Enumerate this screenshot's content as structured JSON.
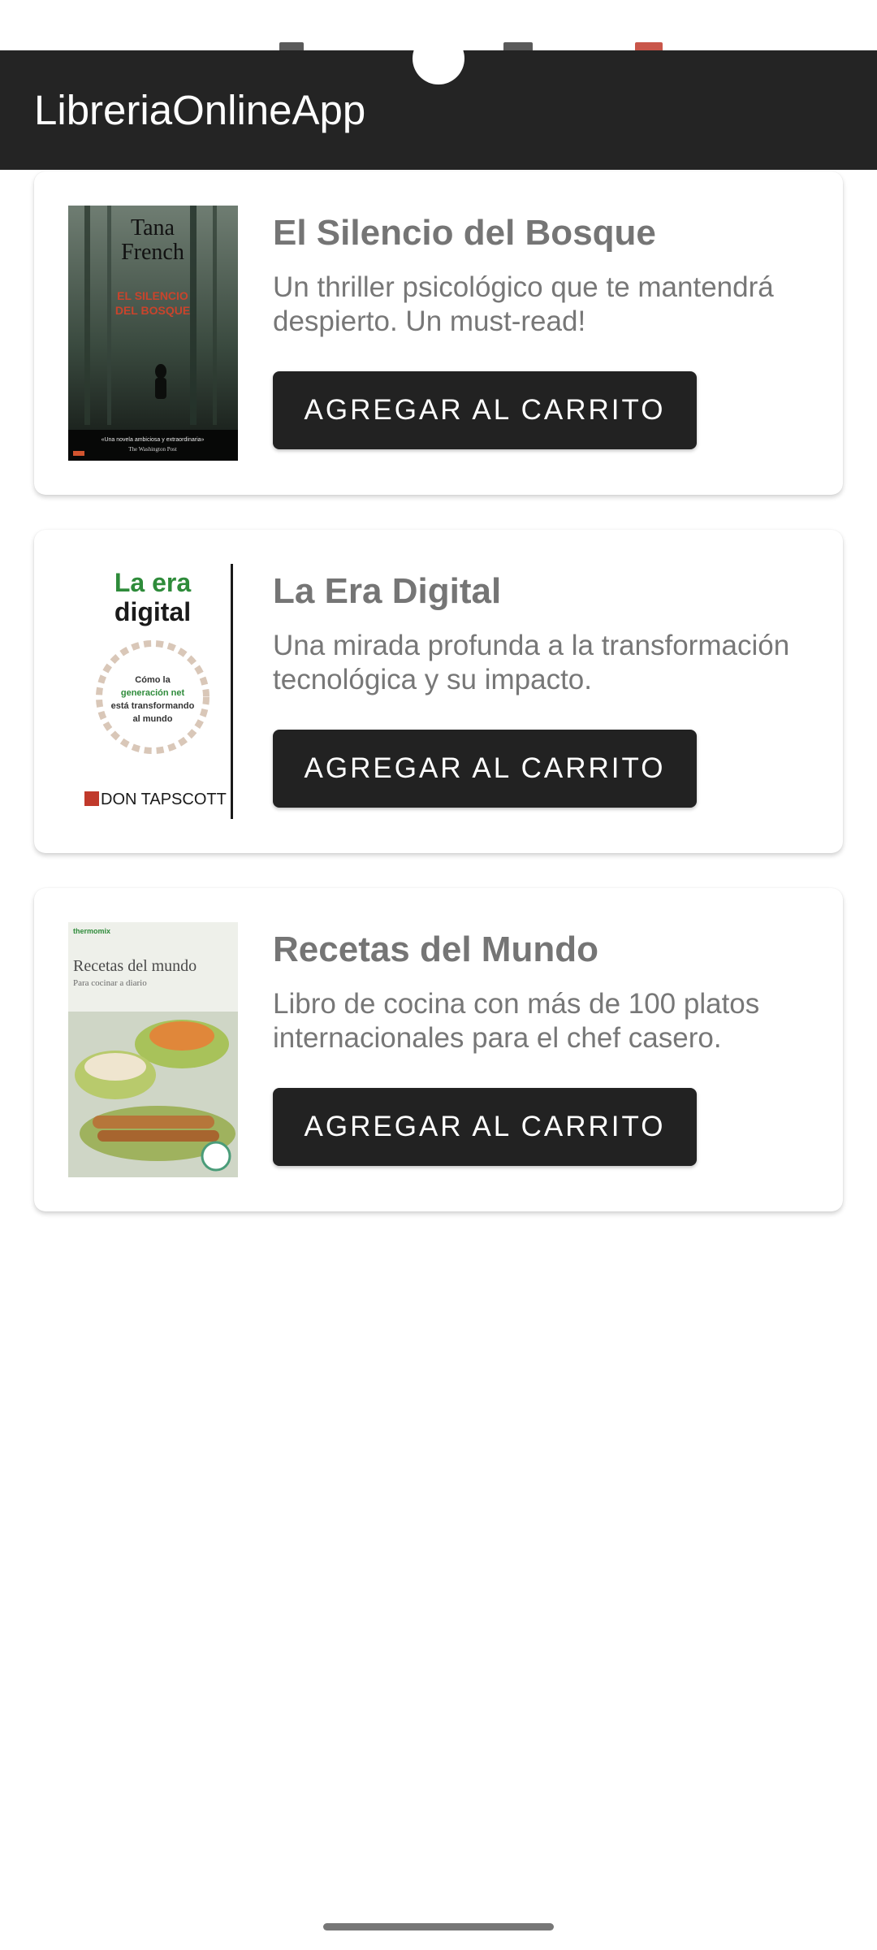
{
  "app": {
    "title": "LibreriaOnlineApp"
  },
  "books": [
    {
      "title": "El Silencio del Bosque",
      "description": "Un thriller psicológico que te mantendrá despierto. Un must-read!",
      "button_label": "AGREGAR AL CARRITO",
      "cover": {
        "author": [
          "Tana",
          "French"
        ],
        "title_lines": [
          "EL SILENCIO",
          "DEL BOSQUE"
        ],
        "quote": "«Una novela ambiciosa y extraordinaria»",
        "quote_source": "The Washington Post"
      }
    },
    {
      "title": "La Era Digital",
      "description": "Una mirada profunda a la transformación tecnológica y su impacto.",
      "button_label": "AGREGAR AL CARRITO",
      "cover": {
        "title_lines": [
          "La era",
          "digital"
        ],
        "subtitle_lines": [
          "Cómo la",
          "generación net",
          "está transformando",
          "al mundo"
        ],
        "author": "DON TAPSCOTT"
      }
    },
    {
      "title": "Recetas del Mundo",
      "description": "Libro de cocina con más de 100 platos internacionales para el chef casero.",
      "button_label": "AGREGAR AL CARRITO",
      "cover": {
        "brand": "thermomix",
        "title": "Recetas del mundo",
        "subtitle": "Para cocinar a diario"
      }
    }
  ],
  "colors": {
    "app_bar": "#242424",
    "button": "#222222",
    "title_text": "#757575",
    "desc_text": "#777777"
  }
}
